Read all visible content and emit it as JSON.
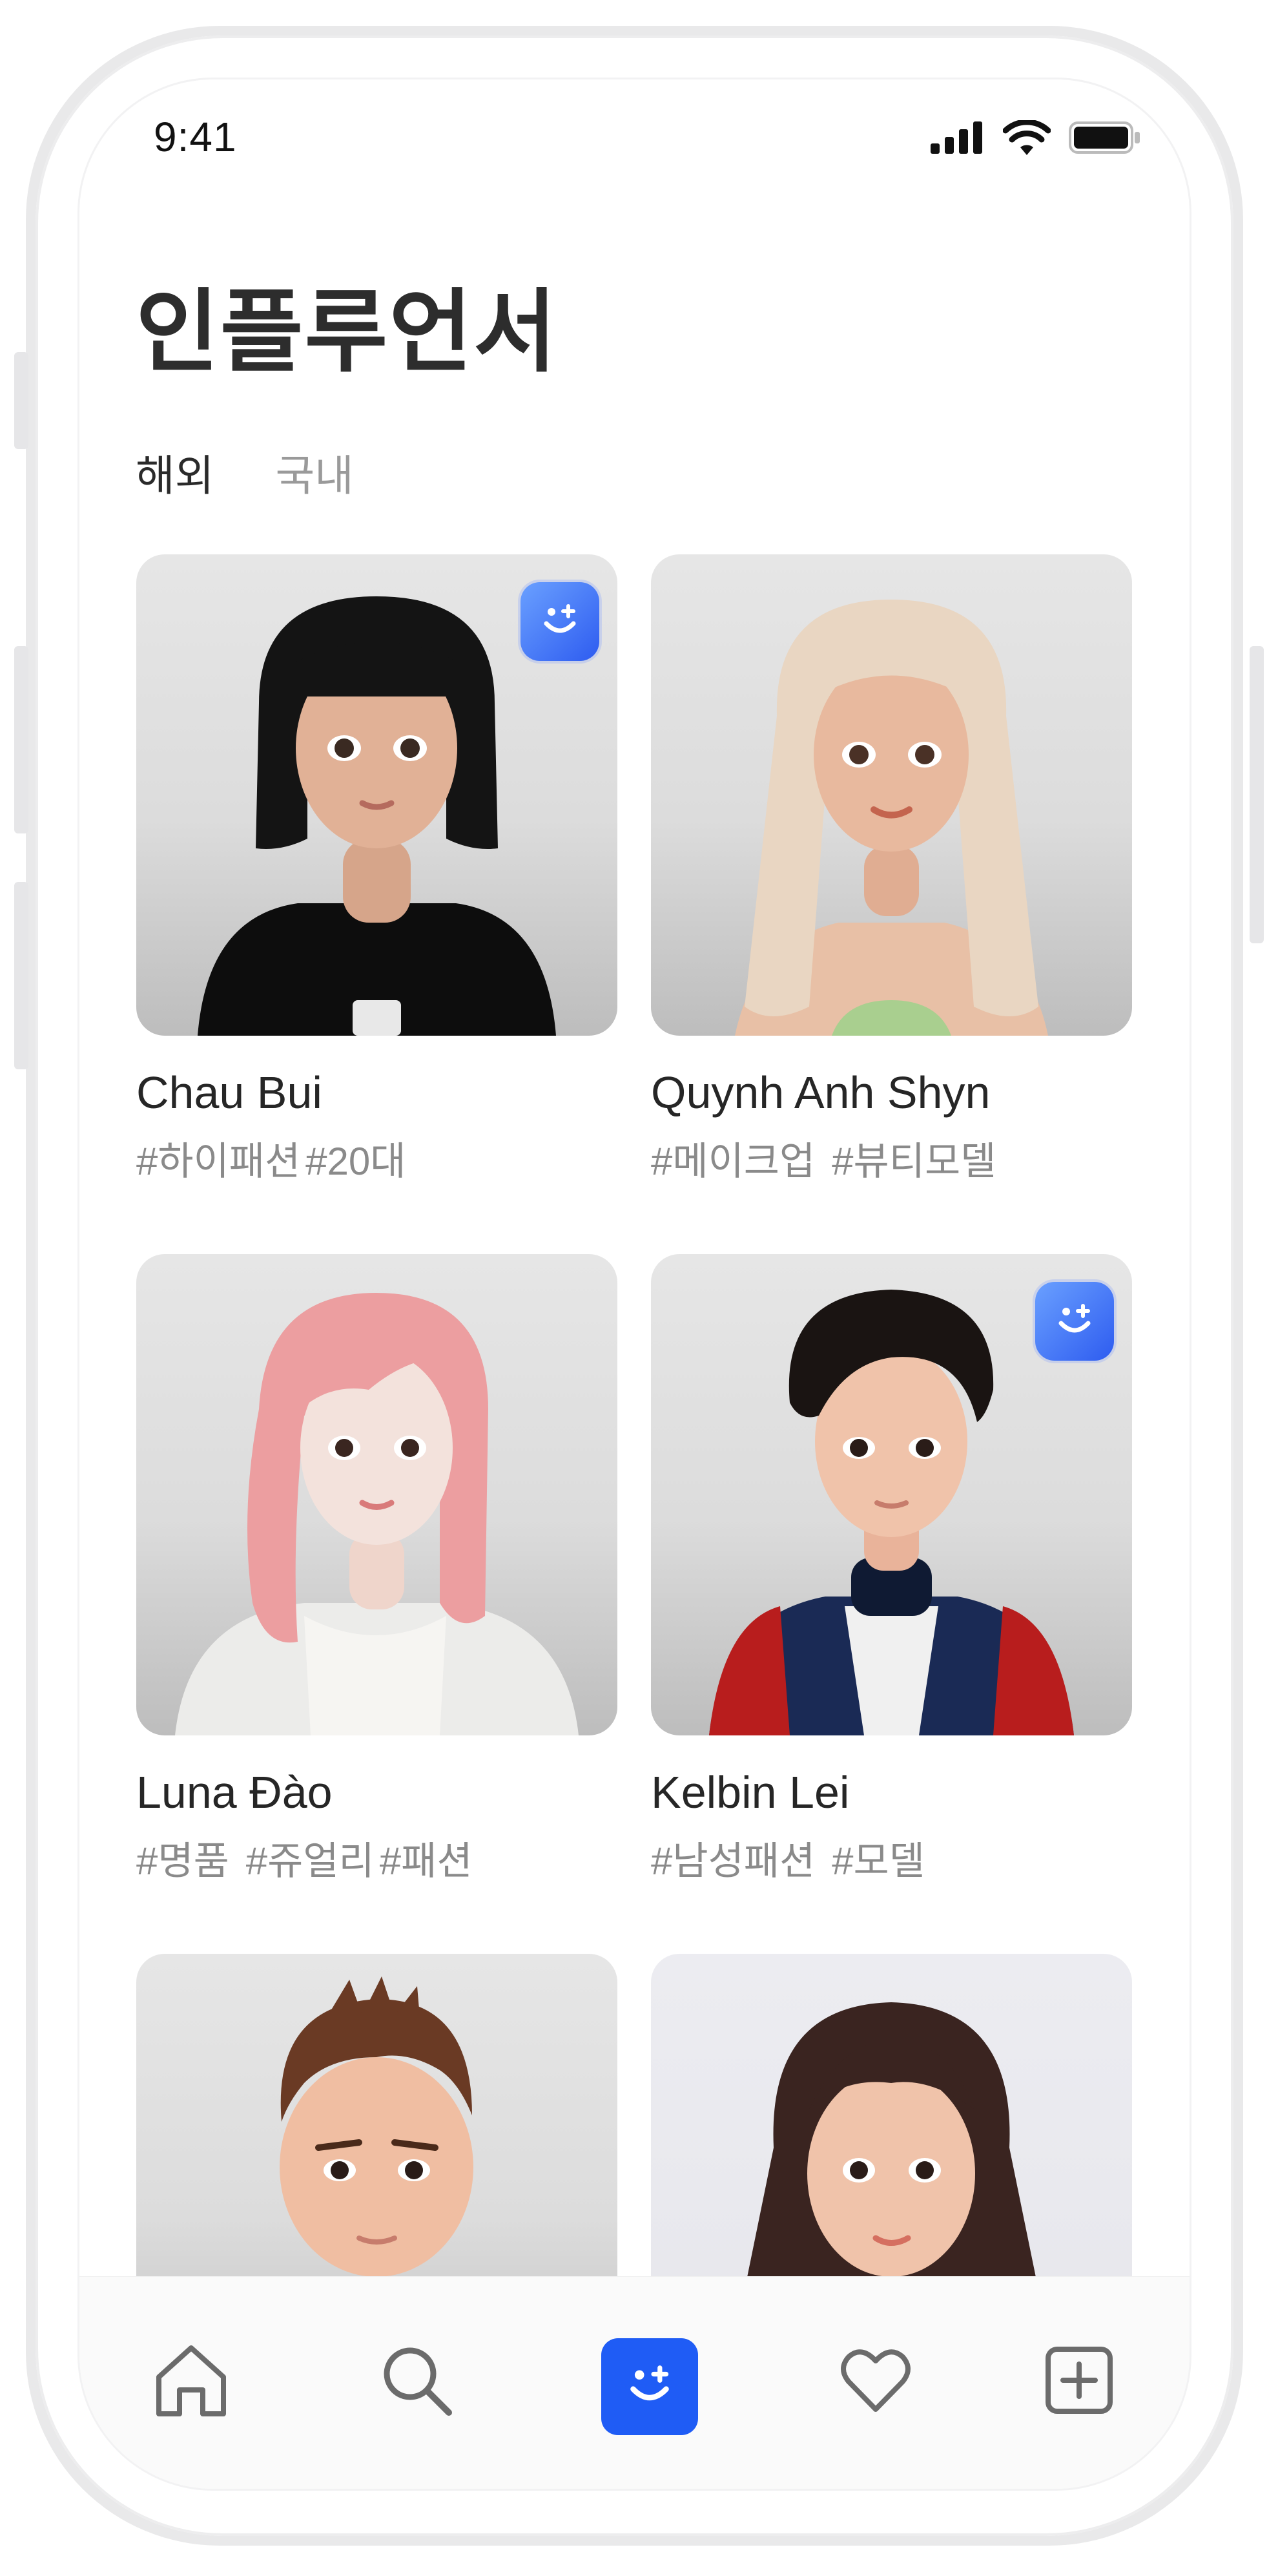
{
  "status_bar": {
    "time": "9:41"
  },
  "page_title": "인플루언서",
  "tabs": [
    {
      "label": "해외",
      "active": true
    },
    {
      "label": "국내",
      "active": false
    }
  ],
  "influencers": [
    {
      "name": "Chau Bui",
      "tags": [
        "#하이패션",
        "#20대"
      ],
      "badge": true
    },
    {
      "name": "Quynh Anh Shyn",
      "tags": [
        "#메이크업",
        "#뷰티모델"
      ],
      "badge": false
    },
    {
      "name": "Luna Đào",
      "tags": [
        "#명품",
        "#쥬얼리",
        "#패션"
      ],
      "badge": false
    },
    {
      "name": "Kelbin Lei",
      "tags": [
        "#남성패션",
        "#모델"
      ],
      "badge": true
    },
    {
      "name": "",
      "tags": [],
      "badge": false
    },
    {
      "name": "",
      "tags": [],
      "badge": false
    }
  ],
  "bottom_nav": {
    "items": [
      "home-icon",
      "search-icon",
      "zepeto-face-icon",
      "heart-icon",
      "add-icon"
    ],
    "active": "zepeto-face-icon"
  },
  "colors": {
    "accent": "#1f5cf5",
    "badge_gradient": [
      "#6aa0ff",
      "#2e5cf0"
    ],
    "tag_text": "#8a8a8a"
  }
}
